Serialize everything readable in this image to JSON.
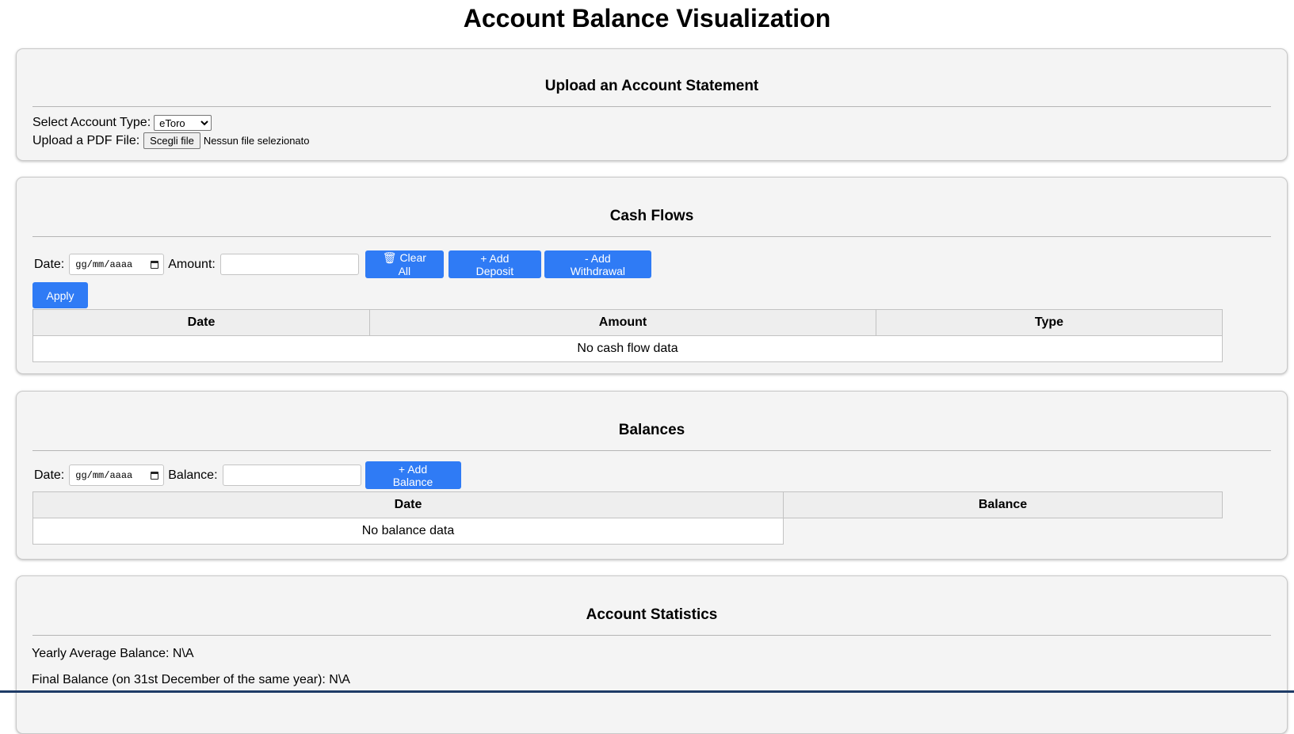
{
  "page": {
    "title": "Account Balance Visualization"
  },
  "upload": {
    "heading": "Upload an Account Statement",
    "account_type_label": "Select Account Type:",
    "account_type_selected": "eToro",
    "pdf_label": "Upload a PDF File:",
    "file_button": "Scegli file",
    "file_status": "Nessun file selezionato"
  },
  "cash_flows": {
    "heading": "Cash Flows",
    "date_label": "Date:",
    "date_placeholder": "gg/mm/aaaa",
    "amount_label": "Amount:",
    "clear_all_button": "🗑 Clear All",
    "add_deposit_button": "+ Add Deposit",
    "add_withdrawal_button": "- Add Withdrawal",
    "apply_button": "Apply",
    "columns": [
      "Date",
      "Amount",
      "Type"
    ],
    "empty_message": "No cash flow data"
  },
  "balances": {
    "heading": "Balances",
    "date_label": "Date:",
    "date_placeholder": "gg/mm/aaaa",
    "balance_label": "Balance:",
    "add_balance_button": "+ Add Balance",
    "columns": [
      "Date",
      "Balance"
    ],
    "empty_message": "No balance data"
  },
  "statistics": {
    "heading": "Account Statistics",
    "yearly_average": "Yearly Average Balance: N\\A",
    "final_balance": "Final Balance (on 31st December of the same year): N\\A"
  },
  "colors": {
    "accent": "#2f7bf5",
    "panel_bg": "#f4f4f4",
    "bottom_rule": "#1e3b66"
  }
}
